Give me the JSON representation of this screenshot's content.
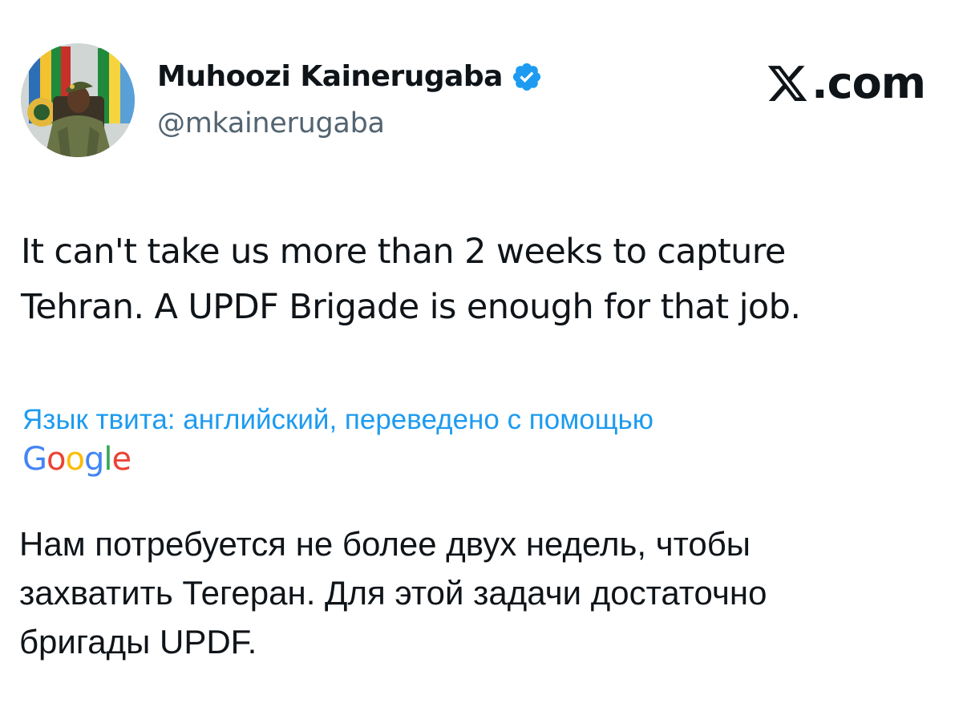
{
  "author": {
    "display_name": "Muhoozi Kainerugaba",
    "handle": "@mkainerugaba",
    "verified": true,
    "badge_color": "#1d9bf0"
  },
  "brand": {
    "mark_icon": "x-logo-icon",
    "text": ".com"
  },
  "tweet": {
    "text_lines": [
      "It can't take us more than 2 weeks to capture",
      "Tehran. A UPDF Brigade is enough for that job."
    ]
  },
  "translation": {
    "note": "Язык твита: английский, переведено с помощью",
    "provider_logo": [
      "G",
      "o",
      "o",
      "g",
      "l",
      "e"
    ],
    "provider_colors": [
      "#4285f4",
      "#ea4335",
      "#fbbc05",
      "#4285f4",
      "#34a853",
      "#ea4335"
    ],
    "note_color": "#1d9bf0",
    "text_lines": [
      "Нам потребуется не более двух недель, чтобы",
      "захватить Тегеран. Для этой задачи достаточно",
      "бригады UPDF."
    ]
  }
}
